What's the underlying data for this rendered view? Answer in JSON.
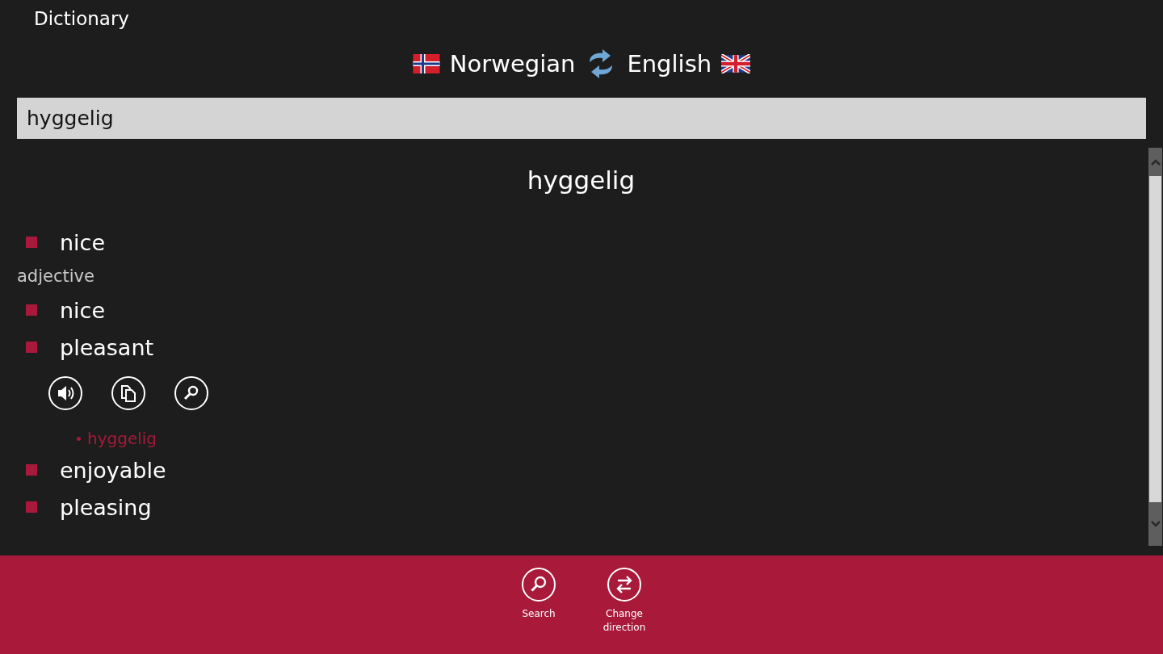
{
  "window": {
    "title": "Dictionary"
  },
  "languages": {
    "source": "Norwegian",
    "target": "English"
  },
  "search": {
    "value": "hyggelig"
  },
  "entry": {
    "headword": "hyggelig",
    "lines": [
      {
        "kind": "sense",
        "text": "nice"
      },
      {
        "kind": "pos",
        "text": "adjective"
      },
      {
        "kind": "sense",
        "text": "nice"
      },
      {
        "kind": "sense",
        "text": "pleasant"
      },
      {
        "kind": "actions"
      },
      {
        "kind": "example",
        "text": "hyggelig"
      },
      {
        "kind": "sense",
        "text": "enjoyable"
      },
      {
        "kind": "sense",
        "text": "pleasing"
      }
    ]
  },
  "app_bar": [
    {
      "kind": "search",
      "label": "Search"
    },
    {
      "kind": "swap",
      "label": "Change\ndirection"
    }
  ]
}
